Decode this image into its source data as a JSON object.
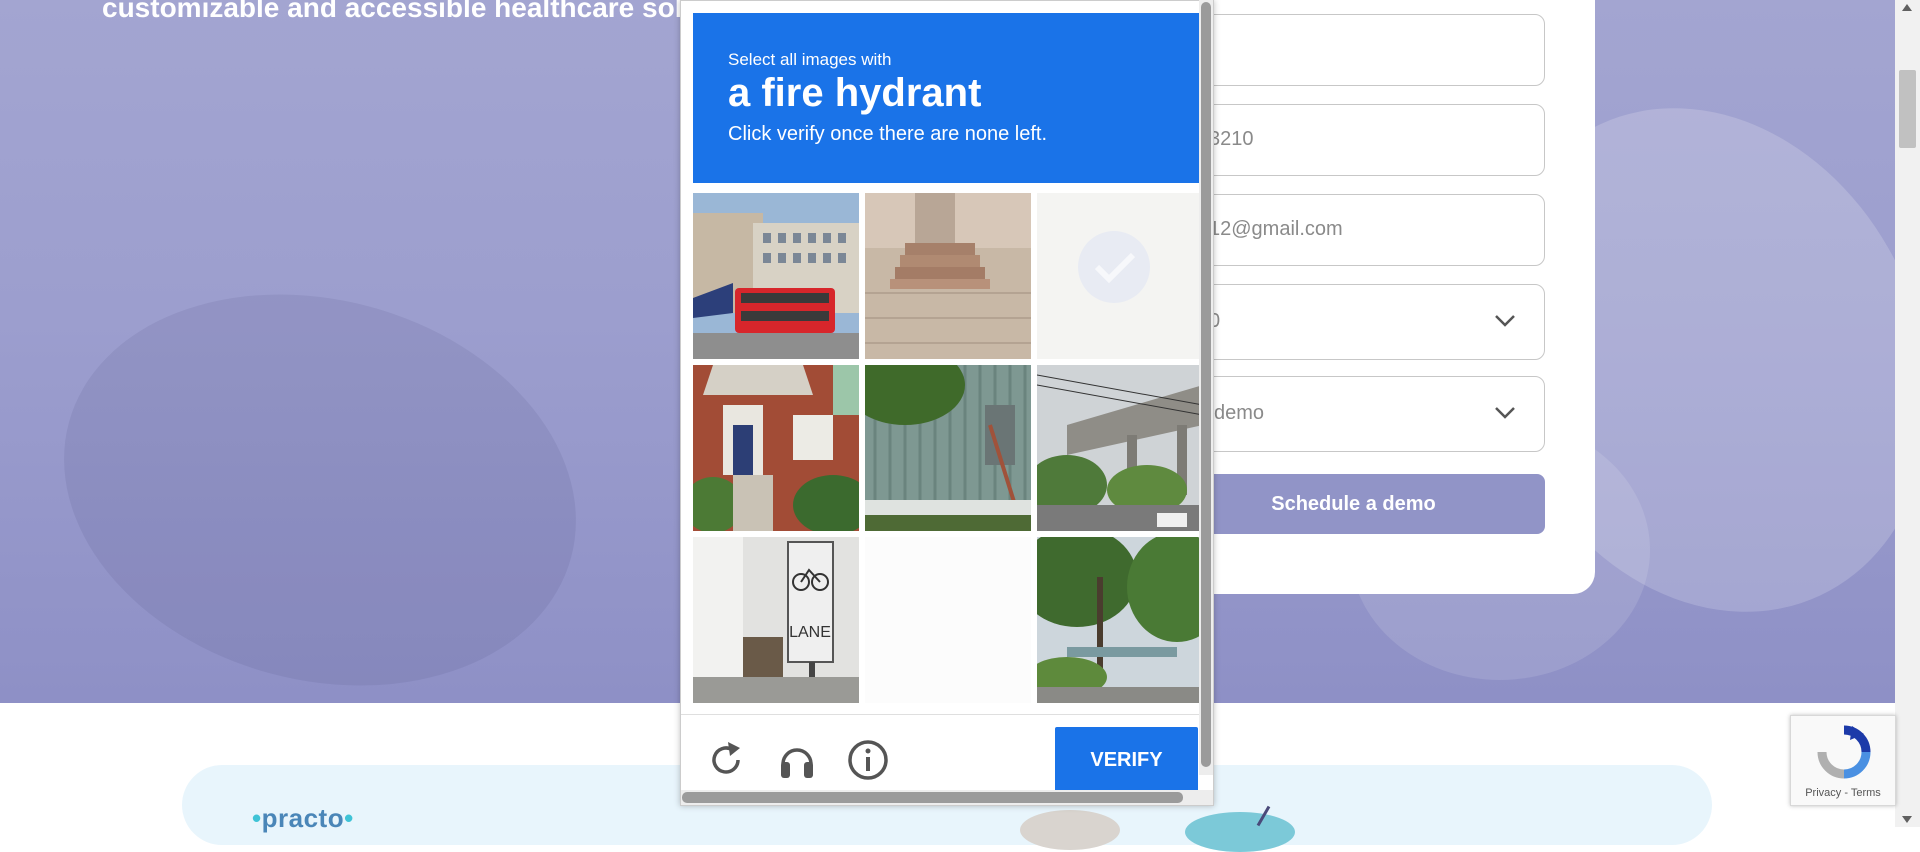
{
  "hero": {
    "subtitle": "customizable and accessible healthcare solu"
  },
  "form": {
    "phone_value": "3210",
    "email_value": "12@gmail.com",
    "select1_value": "0",
    "select2_value": "demo",
    "schedule_label": "Schedule a demo"
  },
  "partner": {
    "logo_text": "practo"
  },
  "captcha": {
    "instruction_line1": "Select all images with",
    "target_object": "a fire hydrant",
    "instruction_line2": "Click verify once there are none left.",
    "verify_label": "VERIFY",
    "tiles": [
      {
        "content": "bus-street-tile",
        "selected": false
      },
      {
        "content": "steps-tile",
        "selected": false
      },
      {
        "content": "selected-fading-tile",
        "selected": true
      },
      {
        "content": "brick-house-tile",
        "selected": false
      },
      {
        "content": "green-wall-tile",
        "selected": false
      },
      {
        "content": "highway-tile",
        "selected": false
      },
      {
        "content": "bike-lane-sign-tile",
        "selected": false
      },
      {
        "content": "blank-loading-tile",
        "selected": false
      },
      {
        "content": "trees-road-tile",
        "selected": false
      }
    ],
    "tile_texts": [
      "LANE"
    ]
  },
  "recaptcha_badge": {
    "privacy": "Privacy",
    "separator": " - ",
    "terms": "Terms"
  },
  "colors": {
    "captcha_blue": "#1a73e8",
    "hero_purple": "#9c9ece",
    "schedule_button": "#9194c7"
  }
}
